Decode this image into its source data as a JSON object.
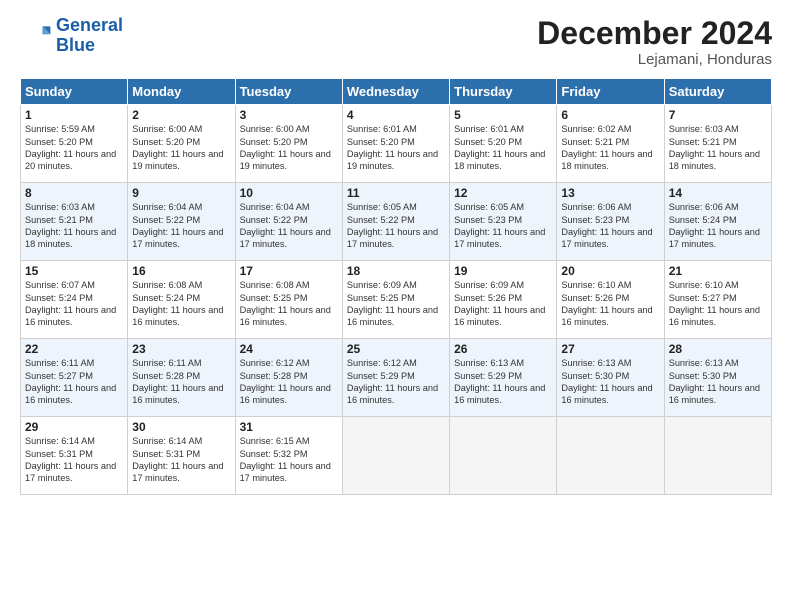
{
  "logo": {
    "line1": "General",
    "line2": "Blue"
  },
  "title": "December 2024",
  "location": "Lejamani, Honduras",
  "days_of_week": [
    "Sunday",
    "Monday",
    "Tuesday",
    "Wednesday",
    "Thursday",
    "Friday",
    "Saturday"
  ],
  "weeks": [
    [
      {
        "day": 1,
        "text": "Sunrise: 5:59 AM\nSunset: 5:20 PM\nDaylight: 11 hours\nand 20 minutes."
      },
      {
        "day": 2,
        "text": "Sunrise: 6:00 AM\nSunset: 5:20 PM\nDaylight: 11 hours\nand 19 minutes."
      },
      {
        "day": 3,
        "text": "Sunrise: 6:00 AM\nSunset: 5:20 PM\nDaylight: 11 hours\nand 19 minutes."
      },
      {
        "day": 4,
        "text": "Sunrise: 6:01 AM\nSunset: 5:20 PM\nDaylight: 11 hours\nand 19 minutes."
      },
      {
        "day": 5,
        "text": "Sunrise: 6:01 AM\nSunset: 5:20 PM\nDaylight: 11 hours\nand 18 minutes."
      },
      {
        "day": 6,
        "text": "Sunrise: 6:02 AM\nSunset: 5:21 PM\nDaylight: 11 hours\nand 18 minutes."
      },
      {
        "day": 7,
        "text": "Sunrise: 6:03 AM\nSunset: 5:21 PM\nDaylight: 11 hours\nand 18 minutes."
      }
    ],
    [
      {
        "day": 8,
        "text": "Sunrise: 6:03 AM\nSunset: 5:21 PM\nDaylight: 11 hours\nand 18 minutes."
      },
      {
        "day": 9,
        "text": "Sunrise: 6:04 AM\nSunset: 5:22 PM\nDaylight: 11 hours\nand 17 minutes."
      },
      {
        "day": 10,
        "text": "Sunrise: 6:04 AM\nSunset: 5:22 PM\nDaylight: 11 hours\nand 17 minutes."
      },
      {
        "day": 11,
        "text": "Sunrise: 6:05 AM\nSunset: 5:22 PM\nDaylight: 11 hours\nand 17 minutes."
      },
      {
        "day": 12,
        "text": "Sunrise: 6:05 AM\nSunset: 5:23 PM\nDaylight: 11 hours\nand 17 minutes."
      },
      {
        "day": 13,
        "text": "Sunrise: 6:06 AM\nSunset: 5:23 PM\nDaylight: 11 hours\nand 17 minutes."
      },
      {
        "day": 14,
        "text": "Sunrise: 6:06 AM\nSunset: 5:24 PM\nDaylight: 11 hours\nand 17 minutes."
      }
    ],
    [
      {
        "day": 15,
        "text": "Sunrise: 6:07 AM\nSunset: 5:24 PM\nDaylight: 11 hours\nand 16 minutes."
      },
      {
        "day": 16,
        "text": "Sunrise: 6:08 AM\nSunset: 5:24 PM\nDaylight: 11 hours\nand 16 minutes."
      },
      {
        "day": 17,
        "text": "Sunrise: 6:08 AM\nSunset: 5:25 PM\nDaylight: 11 hours\nand 16 minutes."
      },
      {
        "day": 18,
        "text": "Sunrise: 6:09 AM\nSunset: 5:25 PM\nDaylight: 11 hours\nand 16 minutes."
      },
      {
        "day": 19,
        "text": "Sunrise: 6:09 AM\nSunset: 5:26 PM\nDaylight: 11 hours\nand 16 minutes."
      },
      {
        "day": 20,
        "text": "Sunrise: 6:10 AM\nSunset: 5:26 PM\nDaylight: 11 hours\nand 16 minutes."
      },
      {
        "day": 21,
        "text": "Sunrise: 6:10 AM\nSunset: 5:27 PM\nDaylight: 11 hours\nand 16 minutes."
      }
    ],
    [
      {
        "day": 22,
        "text": "Sunrise: 6:11 AM\nSunset: 5:27 PM\nDaylight: 11 hours\nand 16 minutes."
      },
      {
        "day": 23,
        "text": "Sunrise: 6:11 AM\nSunset: 5:28 PM\nDaylight: 11 hours\nand 16 minutes."
      },
      {
        "day": 24,
        "text": "Sunrise: 6:12 AM\nSunset: 5:28 PM\nDaylight: 11 hours\nand 16 minutes."
      },
      {
        "day": 25,
        "text": "Sunrise: 6:12 AM\nSunset: 5:29 PM\nDaylight: 11 hours\nand 16 minutes."
      },
      {
        "day": 26,
        "text": "Sunrise: 6:13 AM\nSunset: 5:29 PM\nDaylight: 11 hours\nand 16 minutes."
      },
      {
        "day": 27,
        "text": "Sunrise: 6:13 AM\nSunset: 5:30 PM\nDaylight: 11 hours\nand 16 minutes."
      },
      {
        "day": 28,
        "text": "Sunrise: 6:13 AM\nSunset: 5:30 PM\nDaylight: 11 hours\nand 16 minutes."
      }
    ],
    [
      {
        "day": 29,
        "text": "Sunrise: 6:14 AM\nSunset: 5:31 PM\nDaylight: 11 hours\nand 17 minutes."
      },
      {
        "day": 30,
        "text": "Sunrise: 6:14 AM\nSunset: 5:31 PM\nDaylight: 11 hours\nand 17 minutes."
      },
      {
        "day": 31,
        "text": "Sunrise: 6:15 AM\nSunset: 5:32 PM\nDaylight: 11 hours\nand 17 minutes."
      },
      {
        "day": null,
        "text": ""
      },
      {
        "day": null,
        "text": ""
      },
      {
        "day": null,
        "text": ""
      },
      {
        "day": null,
        "text": ""
      }
    ]
  ]
}
